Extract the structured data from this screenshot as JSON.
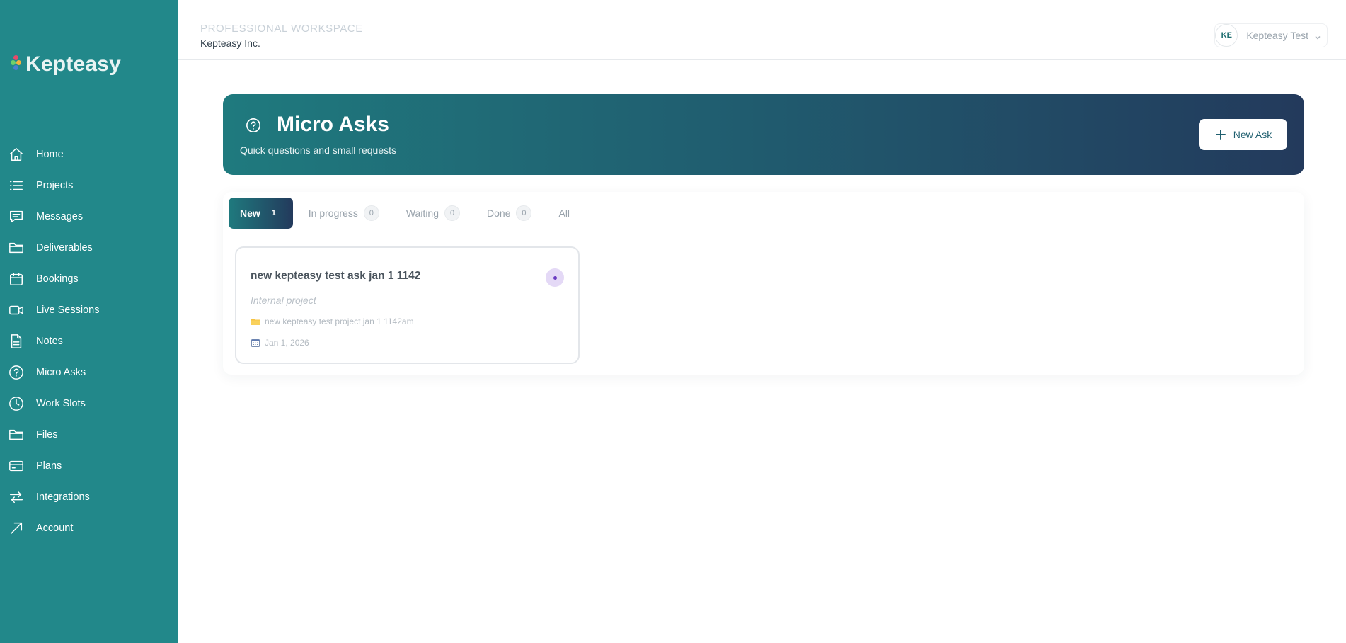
{
  "app": {
    "name": "Kepteasy"
  },
  "sidebar": {
    "items": [
      {
        "label": "Home",
        "icon": "home-icon"
      },
      {
        "label": "Projects",
        "icon": "list-icon"
      },
      {
        "label": "Messages",
        "icon": "message-icon"
      },
      {
        "label": "Deliverables",
        "icon": "folder-icon"
      },
      {
        "label": "Bookings",
        "icon": "calendar-icon"
      },
      {
        "label": "Live Sessions",
        "icon": "video-icon"
      },
      {
        "label": "Notes",
        "icon": "document-icon"
      },
      {
        "label": "Micro Asks",
        "icon": "question-icon"
      },
      {
        "label": "Work Slots",
        "icon": "clock-icon"
      },
      {
        "label": "Files",
        "icon": "folder-icon"
      },
      {
        "label": "Plans",
        "icon": "credit-card-icon"
      },
      {
        "label": "Integrations",
        "icon": "arrows-icon"
      },
      {
        "label": "Account",
        "icon": "arrow-up-right-icon"
      }
    ]
  },
  "header": {
    "workspace_label": "PROFESSIONAL WORKSPACE",
    "workspace_name": "Kepteasy Inc.",
    "user": {
      "initials": "KE",
      "name": "Kepteasy Test"
    }
  },
  "banner": {
    "title": "Micro Asks",
    "subtitle": "Quick questions and small requests",
    "new_button_label": "New Ask"
  },
  "tabs": [
    {
      "label": "New",
      "count": "1",
      "active": true
    },
    {
      "label": "In progress",
      "count": "0",
      "active": false
    },
    {
      "label": "Waiting",
      "count": "0",
      "active": false
    },
    {
      "label": "Done",
      "count": "0",
      "active": false
    },
    {
      "label": "All",
      "count": null,
      "active": false
    }
  ],
  "cards": [
    {
      "title": "new kepteasy test ask jan 1 1142",
      "project_type": "Internal project",
      "project_name": "new kepteasy test project jan 1 1142am",
      "date": "Jan 1, 2026",
      "status_color": "#6a3bc2"
    }
  ],
  "colors": {
    "sidebar": "#22888a",
    "banner_start": "#1f7a7e",
    "banner_end": "#233a5c"
  }
}
